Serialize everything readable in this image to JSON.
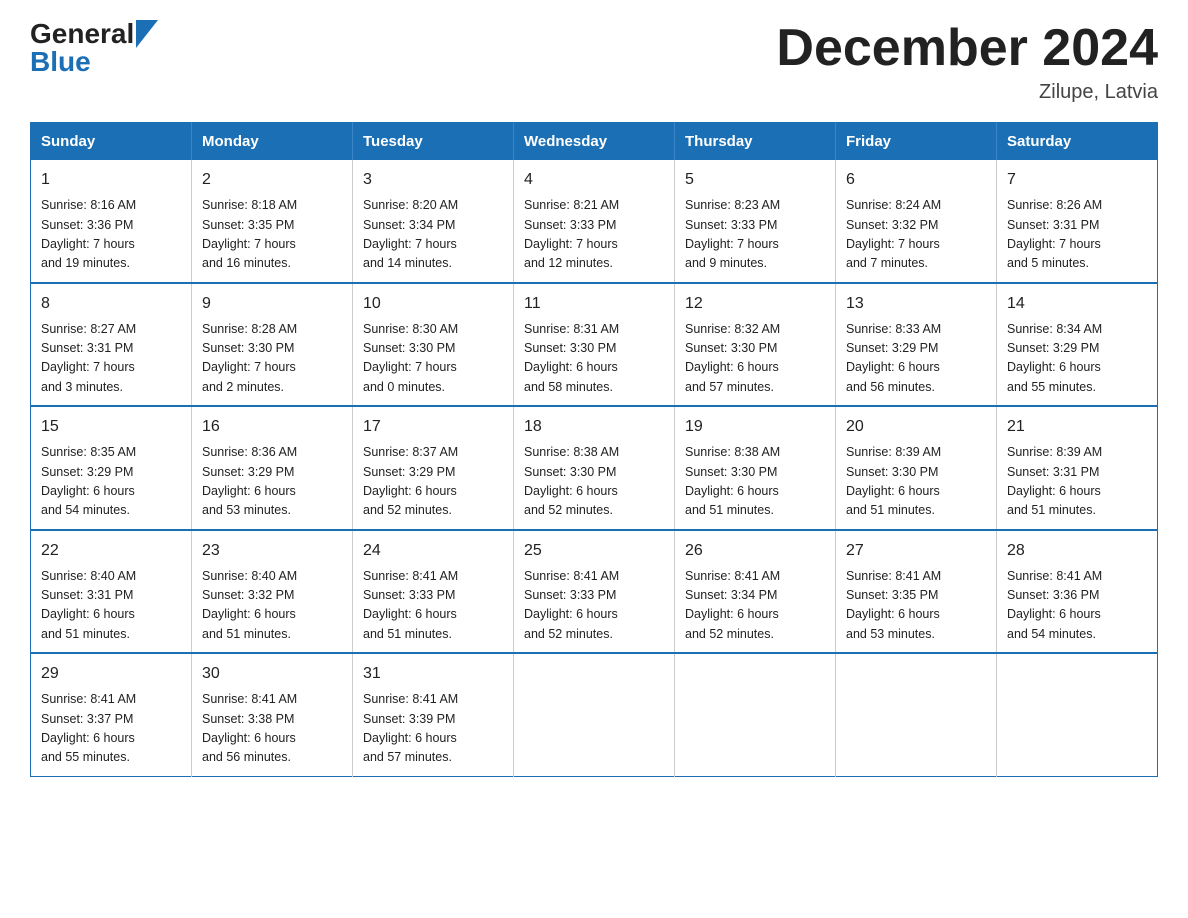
{
  "header": {
    "logo_general": "General",
    "logo_blue": "Blue",
    "title": "December 2024",
    "subtitle": "Zilupe, Latvia"
  },
  "calendar": {
    "weekdays": [
      "Sunday",
      "Monday",
      "Tuesday",
      "Wednesday",
      "Thursday",
      "Friday",
      "Saturday"
    ],
    "weeks": [
      [
        {
          "day": "1",
          "info": "Sunrise: 8:16 AM\nSunset: 3:36 PM\nDaylight: 7 hours\nand 19 minutes."
        },
        {
          "day": "2",
          "info": "Sunrise: 8:18 AM\nSunset: 3:35 PM\nDaylight: 7 hours\nand 16 minutes."
        },
        {
          "day": "3",
          "info": "Sunrise: 8:20 AM\nSunset: 3:34 PM\nDaylight: 7 hours\nand 14 minutes."
        },
        {
          "day": "4",
          "info": "Sunrise: 8:21 AM\nSunset: 3:33 PM\nDaylight: 7 hours\nand 12 minutes."
        },
        {
          "day": "5",
          "info": "Sunrise: 8:23 AM\nSunset: 3:33 PM\nDaylight: 7 hours\nand 9 minutes."
        },
        {
          "day": "6",
          "info": "Sunrise: 8:24 AM\nSunset: 3:32 PM\nDaylight: 7 hours\nand 7 minutes."
        },
        {
          "day": "7",
          "info": "Sunrise: 8:26 AM\nSunset: 3:31 PM\nDaylight: 7 hours\nand 5 minutes."
        }
      ],
      [
        {
          "day": "8",
          "info": "Sunrise: 8:27 AM\nSunset: 3:31 PM\nDaylight: 7 hours\nand 3 minutes."
        },
        {
          "day": "9",
          "info": "Sunrise: 8:28 AM\nSunset: 3:30 PM\nDaylight: 7 hours\nand 2 minutes."
        },
        {
          "day": "10",
          "info": "Sunrise: 8:30 AM\nSunset: 3:30 PM\nDaylight: 7 hours\nand 0 minutes."
        },
        {
          "day": "11",
          "info": "Sunrise: 8:31 AM\nSunset: 3:30 PM\nDaylight: 6 hours\nand 58 minutes."
        },
        {
          "day": "12",
          "info": "Sunrise: 8:32 AM\nSunset: 3:30 PM\nDaylight: 6 hours\nand 57 minutes."
        },
        {
          "day": "13",
          "info": "Sunrise: 8:33 AM\nSunset: 3:29 PM\nDaylight: 6 hours\nand 56 minutes."
        },
        {
          "day": "14",
          "info": "Sunrise: 8:34 AM\nSunset: 3:29 PM\nDaylight: 6 hours\nand 55 minutes."
        }
      ],
      [
        {
          "day": "15",
          "info": "Sunrise: 8:35 AM\nSunset: 3:29 PM\nDaylight: 6 hours\nand 54 minutes."
        },
        {
          "day": "16",
          "info": "Sunrise: 8:36 AM\nSunset: 3:29 PM\nDaylight: 6 hours\nand 53 minutes."
        },
        {
          "day": "17",
          "info": "Sunrise: 8:37 AM\nSunset: 3:29 PM\nDaylight: 6 hours\nand 52 minutes."
        },
        {
          "day": "18",
          "info": "Sunrise: 8:38 AM\nSunset: 3:30 PM\nDaylight: 6 hours\nand 52 minutes."
        },
        {
          "day": "19",
          "info": "Sunrise: 8:38 AM\nSunset: 3:30 PM\nDaylight: 6 hours\nand 51 minutes."
        },
        {
          "day": "20",
          "info": "Sunrise: 8:39 AM\nSunset: 3:30 PM\nDaylight: 6 hours\nand 51 minutes."
        },
        {
          "day": "21",
          "info": "Sunrise: 8:39 AM\nSunset: 3:31 PM\nDaylight: 6 hours\nand 51 minutes."
        }
      ],
      [
        {
          "day": "22",
          "info": "Sunrise: 8:40 AM\nSunset: 3:31 PM\nDaylight: 6 hours\nand 51 minutes."
        },
        {
          "day": "23",
          "info": "Sunrise: 8:40 AM\nSunset: 3:32 PM\nDaylight: 6 hours\nand 51 minutes."
        },
        {
          "day": "24",
          "info": "Sunrise: 8:41 AM\nSunset: 3:33 PM\nDaylight: 6 hours\nand 51 minutes."
        },
        {
          "day": "25",
          "info": "Sunrise: 8:41 AM\nSunset: 3:33 PM\nDaylight: 6 hours\nand 52 minutes."
        },
        {
          "day": "26",
          "info": "Sunrise: 8:41 AM\nSunset: 3:34 PM\nDaylight: 6 hours\nand 52 minutes."
        },
        {
          "day": "27",
          "info": "Sunrise: 8:41 AM\nSunset: 3:35 PM\nDaylight: 6 hours\nand 53 minutes."
        },
        {
          "day": "28",
          "info": "Sunrise: 8:41 AM\nSunset: 3:36 PM\nDaylight: 6 hours\nand 54 minutes."
        }
      ],
      [
        {
          "day": "29",
          "info": "Sunrise: 8:41 AM\nSunset: 3:37 PM\nDaylight: 6 hours\nand 55 minutes."
        },
        {
          "day": "30",
          "info": "Sunrise: 8:41 AM\nSunset: 3:38 PM\nDaylight: 6 hours\nand 56 minutes."
        },
        {
          "day": "31",
          "info": "Sunrise: 8:41 AM\nSunset: 3:39 PM\nDaylight: 6 hours\nand 57 minutes."
        },
        {
          "day": "",
          "info": ""
        },
        {
          "day": "",
          "info": ""
        },
        {
          "day": "",
          "info": ""
        },
        {
          "day": "",
          "info": ""
        }
      ]
    ]
  }
}
